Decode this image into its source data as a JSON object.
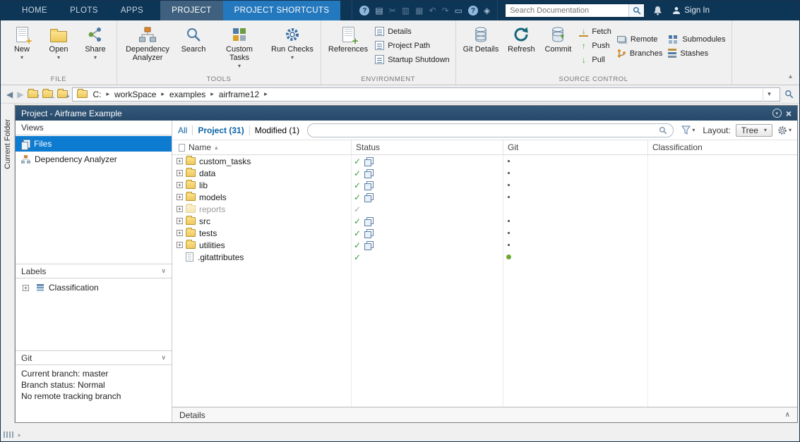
{
  "icons": {
    "check": "✓",
    "expand": "+",
    "sort_asc": "▴",
    "dropdown": "▾",
    "chevron_down": "∨",
    "chevron_up": "∧",
    "crumb_arrow": "▸",
    "back": "◀",
    "forward": "▶",
    "close": "×",
    "help": "?",
    "cut": "✂",
    "undo": "↶",
    "redo": "↷",
    "save": "▤",
    "copy": "▥",
    "paste": "▦",
    "screen": "▭",
    "options": "◈",
    "minimize_ribbon": "▴",
    "up_arrow": "↑",
    "down_arrow": "↓"
  },
  "tabbar": {
    "tabs": [
      {
        "label": "HOME"
      },
      {
        "label": "PLOTS"
      },
      {
        "label": "APPS"
      },
      {
        "label": "PROJECT"
      },
      {
        "label": "PROJECT SHORTCUTS"
      }
    ],
    "search_placeholder": "Search Documentation",
    "sign_in_label": "Sign In"
  },
  "ribbon": {
    "file": {
      "group_label": "FILE",
      "new_label": "New",
      "open_label": "Open",
      "share_label": "Share"
    },
    "tools": {
      "group_label": "TOOLS",
      "dependency_label": "Dependency Analyzer",
      "search_label": "Search",
      "custom_tasks_label": "Custom Tasks",
      "run_checks_label": "Run Checks"
    },
    "environment": {
      "group_label": "ENVIRONMENT",
      "references_label": "References",
      "details_label": "Details",
      "project_path_label": "Project Path",
      "startup_label": "Startup Shutdown"
    },
    "source_control": {
      "group_label": "SOURCE CONTROL",
      "git_details_label": "Git Details",
      "refresh_label": "Refresh",
      "commit_label": "Commit",
      "fetch_label": "Fetch",
      "push_label": "Push",
      "pull_label": "Pull",
      "remote_label": "Remote",
      "branches_label": "Branches",
      "submodules_label": "Submodules",
      "stashes_label": "Stashes"
    }
  },
  "addressbar": {
    "segments": [
      "C:",
      "workSpace",
      "examples",
      "airframe12"
    ]
  },
  "left_strip": {
    "label": "Current Folder"
  },
  "panel": {
    "title": "Project - Airframe Example",
    "sidebar": {
      "views_header": "Views",
      "files_label": "Files",
      "dependency_label": "Dependency Analyzer",
      "labels_header": "Labels",
      "classification_label": "Classification",
      "git_header": "Git",
      "git_line1": "Current branch: master",
      "git_line2": "Branch status: Normal",
      "git_line3": "No remote tracking branch"
    },
    "filterbar": {
      "all": "All",
      "project": "Project (31)",
      "modified": "Modified (1)",
      "search_value": "",
      "layout_label": "Layout:",
      "layout_value": "Tree"
    },
    "table": {
      "columns": {
        "name": "Name",
        "status": "Status",
        "git": "Git",
        "classification": "Classification"
      },
      "rows": [
        {
          "name": "custom_tasks",
          "type": "folder",
          "status": "checked-modified",
          "git": "dot"
        },
        {
          "name": "data",
          "type": "folder",
          "status": "checked-modified",
          "git": "dot"
        },
        {
          "name": "lib",
          "type": "folder",
          "status": "checked-modified",
          "git": "dot"
        },
        {
          "name": "models",
          "type": "folder",
          "status": "checked-modified",
          "git": "dot"
        },
        {
          "name": "reports",
          "type": "folder-excluded",
          "status": "checked-dim",
          "git": "none"
        },
        {
          "name": "src",
          "type": "folder",
          "status": "checked-modified",
          "git": "dot"
        },
        {
          "name": "tests",
          "type": "folder",
          "status": "checked-modified",
          "git": "dot"
        },
        {
          "name": "utilities",
          "type": "folder",
          "status": "checked-modified",
          "git": "dot"
        },
        {
          "name": ".gitattributes",
          "type": "file",
          "status": "checked",
          "git": "green-dot"
        }
      ]
    },
    "details_label": "Details"
  }
}
